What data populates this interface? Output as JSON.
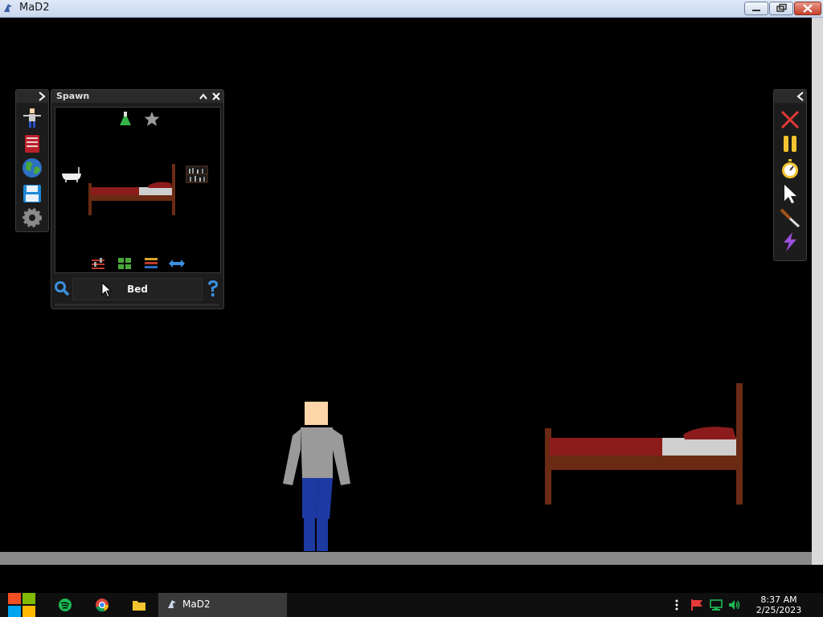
{
  "window": {
    "title": "MaD2",
    "icon": "mad2-app-icon"
  },
  "window_controls": {
    "minimize": "minimize-icon",
    "maximize": "restore-icon",
    "close": "close-icon"
  },
  "left_toolbar": {
    "collapse_icon": "chevron-right-icon",
    "items": [
      "ragdoll-icon",
      "book-icon",
      "globe-icon",
      "save-icon",
      "gear-icon"
    ]
  },
  "spawn_panel": {
    "title": "Spawn",
    "header_buttons": [
      "collapse-icon",
      "close-icon"
    ],
    "filters": [
      "flask-icon",
      "star-icon"
    ],
    "items": [
      "bathtub",
      "bed",
      "bookshelf"
    ],
    "bottom_tools": [
      "sliders-icon",
      "grid-icon",
      "list-icon",
      "swap-arrows-icon"
    ],
    "search": {
      "value": "Bed",
      "icon": "search-icon",
      "help_icon": "help-icon"
    }
  },
  "right_toolbar": {
    "collapse_icon": "chevron-left-icon",
    "items": [
      "delete-x-icon",
      "pause-icon",
      "stopwatch-icon",
      "cursor-icon",
      "knife-icon",
      "lightning-icon"
    ]
  },
  "scene": {
    "objects": [
      "human-ragdoll",
      "bed"
    ]
  },
  "taskbar": {
    "app_label": "MaD2",
    "pinned": [
      "windows-start-icon",
      "spotify-icon",
      "chrome-icon",
      "file-explorer-icon"
    ],
    "tray": [
      "more-icon",
      "flag-icon",
      "network-icon",
      "volume-icon"
    ],
    "time": "8:37 AM",
    "date": "2/25/2023"
  },
  "colors": {
    "bed_frame": "#6a2a14",
    "mattress": "#8c1c1c",
    "sheet": "#cfcfcf",
    "shirt": "#9a9a9a",
    "jeans": "#1d3aa3",
    "skin": "#fcd5a8"
  }
}
